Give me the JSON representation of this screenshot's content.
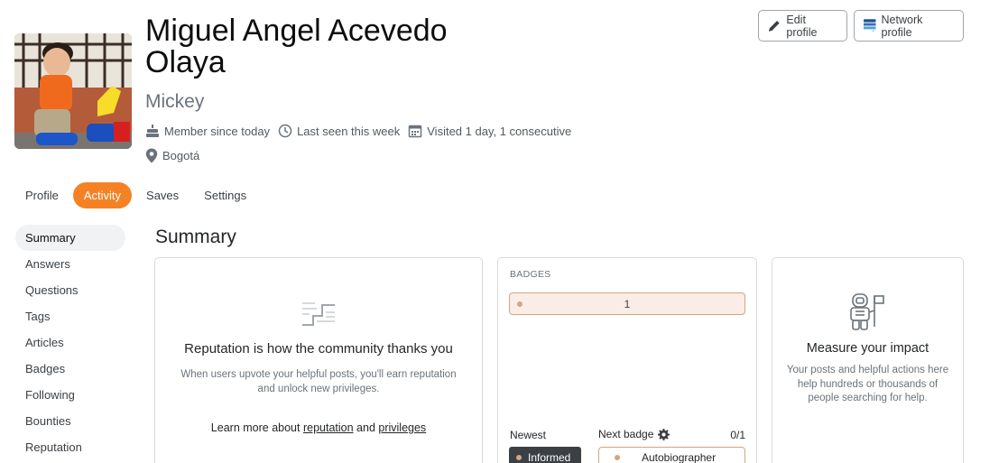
{
  "profile": {
    "name": "Miguel Angel Acevedo Olaya",
    "nickname": "Mickey",
    "member_since": "Member since today",
    "last_seen": "Last seen this week",
    "visited": "Visited 1 day, 1 consecutive",
    "location": "Bogotá"
  },
  "header_buttons": {
    "edit_profile": "Edit profile",
    "network_profile": "Network profile"
  },
  "tabs": [
    {
      "label": "Profile",
      "active": false
    },
    {
      "label": "Activity",
      "active": true
    },
    {
      "label": "Saves",
      "active": false
    },
    {
      "label": "Settings",
      "active": false
    }
  ],
  "sidenav": [
    {
      "label": "Summary",
      "active": true
    },
    {
      "label": "Answers",
      "active": false
    },
    {
      "label": "Questions",
      "active": false
    },
    {
      "label": "Tags",
      "active": false
    },
    {
      "label": "Articles",
      "active": false
    },
    {
      "label": "Badges",
      "active": false
    },
    {
      "label": "Following",
      "active": false
    },
    {
      "label": "Bounties",
      "active": false
    },
    {
      "label": "Reputation",
      "active": false
    }
  ],
  "summary": {
    "title": "Summary",
    "reputation_card": {
      "title": "Reputation is how the community thanks you",
      "description": "When users upvote your helpful posts, you'll earn reputation and unlock new privileges.",
      "learn_prefix": "Learn more about ",
      "link_reputation": "reputation",
      "learn_and": " and ",
      "link_privileges": "privileges"
    },
    "badges_card": {
      "label": "BADGES",
      "bronze_count": "1",
      "newest_label": "Newest",
      "newest_badge": "Informed",
      "next_label": "Next badge",
      "next_progress": "0/1",
      "next_badge": "Autobiographer"
    },
    "impact_card": {
      "title": "Measure your impact",
      "description": "Your posts and helpful actions here help hundreds or thousands of people searching for help."
    }
  },
  "colors": {
    "accent": "#f48225",
    "bronze": "#d1a684",
    "bronze_bg": "#f9ede5"
  }
}
